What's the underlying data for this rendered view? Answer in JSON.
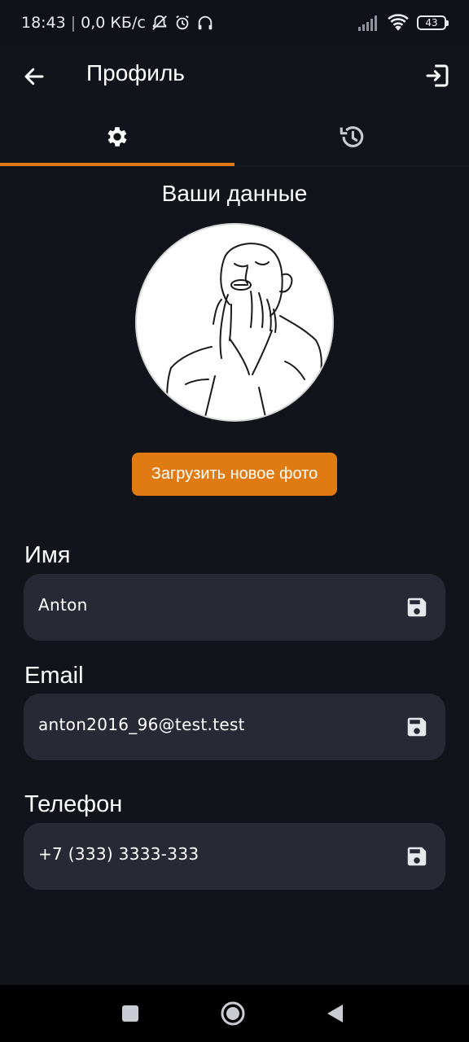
{
  "status_bar": {
    "time": "18:43",
    "separator": "|",
    "net_speed": "0,0 КБ/с",
    "battery": "43"
  },
  "app_bar": {
    "title": "Профиль"
  },
  "tabs": [
    {
      "icon": "gear-icon",
      "active": true
    },
    {
      "icon": "history-icon",
      "active": false
    }
  ],
  "profile": {
    "section_title": "Ваши данные",
    "upload_button": "Загрузить новое фото"
  },
  "fields": {
    "name": {
      "label": "Имя",
      "value": "Anton"
    },
    "email": {
      "label": "Email",
      "value": "anton2016_96@test.test"
    },
    "phone": {
      "label": "Телефон",
      "value": "+7 (333) 3333-333"
    }
  },
  "colors": {
    "accent": "#e07a12",
    "background": "#12141b",
    "field_bg": "#272a34"
  }
}
